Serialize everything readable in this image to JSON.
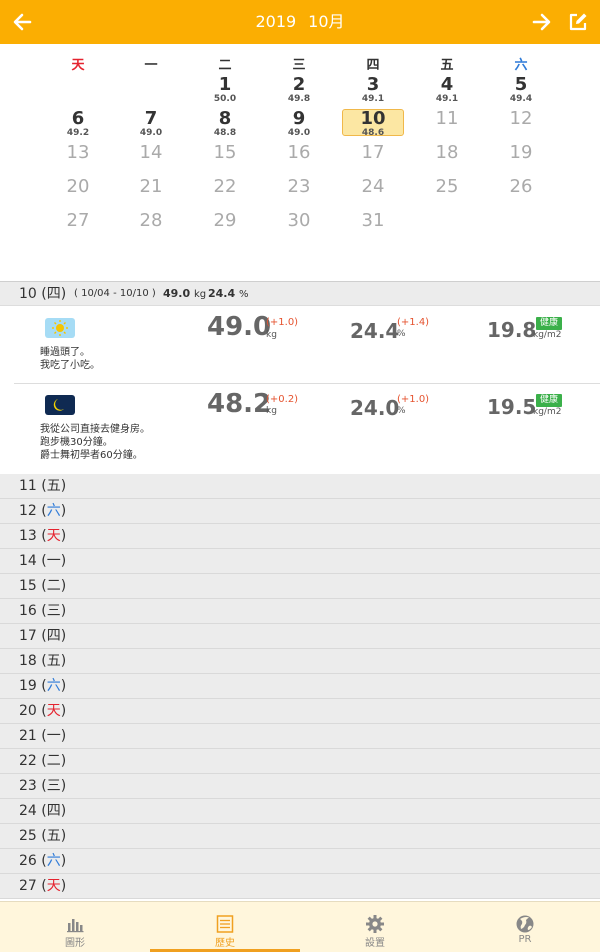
{
  "header": {
    "year": "2019",
    "month": "10月",
    "prev_icon": "arrow-left-icon",
    "next_icon": "arrow-right-icon",
    "edit_icon": "edit-icon"
  },
  "calendar": {
    "weekdays": [
      "天",
      "一",
      "二",
      "三",
      "四",
      "五",
      "六"
    ],
    "days": [
      {
        "n": "1",
        "w": "50.0"
      },
      {
        "n": "2",
        "w": "49.8"
      },
      {
        "n": "3",
        "w": "49.1"
      },
      {
        "n": "4",
        "w": "49.1"
      },
      {
        "n": "5",
        "w": "49.4"
      },
      {
        "n": "6",
        "w": "49.2"
      },
      {
        "n": "7",
        "w": "49.0"
      },
      {
        "n": "8",
        "w": "48.8"
      },
      {
        "n": "9",
        "w": "49.0"
      },
      {
        "n": "10",
        "w": "48.6"
      },
      {
        "n": "11"
      },
      {
        "n": "12"
      },
      {
        "n": "13"
      },
      {
        "n": "14"
      },
      {
        "n": "15"
      },
      {
        "n": "16"
      },
      {
        "n": "17"
      },
      {
        "n": "18"
      },
      {
        "n": "19"
      },
      {
        "n": "20"
      },
      {
        "n": "21"
      },
      {
        "n": "22"
      },
      {
        "n": "23"
      },
      {
        "n": "24"
      },
      {
        "n": "25"
      },
      {
        "n": "26"
      },
      {
        "n": "27"
      },
      {
        "n": "28"
      },
      {
        "n": "29"
      },
      {
        "n": "30"
      },
      {
        "n": "31"
      }
    ],
    "selected": "10"
  },
  "summary": {
    "day": "10 (四)",
    "range": "( 10/04 - 10/10 )",
    "kg_value": "49.0",
    "kg_unit": "kg",
    "pct_value": "24.4",
    "pct_unit": "%"
  },
  "entries": {
    "morning": {
      "icon": "sun-icon",
      "note_line1": "睡過頭了。",
      "note_line2": "我吃了小吃。",
      "weight": "49.0",
      "weight_delta": "(+1.0)",
      "weight_unit": "kg",
      "fat": "24.4",
      "fat_delta": "(+1.4)",
      "fat_unit": "%",
      "bmi": "19.8",
      "bmi_unit": "kg/m2",
      "badge": "健康"
    },
    "evening": {
      "icon": "moon-icon",
      "note_line1": "我從公司直接去健身房。",
      "note_line2": "跑步機30分鐘。",
      "note_line3": "爵士舞初學者60分鐘。",
      "weight": "48.2",
      "weight_delta": "(+0.2)",
      "weight_unit": "kg",
      "fat": "24.0",
      "fat_delta": "(+1.0)",
      "fat_unit": "%",
      "bmi": "19.5",
      "bmi_unit": "kg/m2",
      "badge": "健康"
    }
  },
  "day_list": [
    {
      "num": "11",
      "wd": "五",
      "kind": ""
    },
    {
      "num": "12",
      "wd": "六",
      "kind": "sat"
    },
    {
      "num": "13",
      "wd": "天",
      "kind": "sun"
    },
    {
      "num": "14",
      "wd": "一",
      "kind": ""
    },
    {
      "num": "15",
      "wd": "二",
      "kind": ""
    },
    {
      "num": "16",
      "wd": "三",
      "kind": ""
    },
    {
      "num": "17",
      "wd": "四",
      "kind": ""
    },
    {
      "num": "18",
      "wd": "五",
      "kind": ""
    },
    {
      "num": "19",
      "wd": "六",
      "kind": "sat"
    },
    {
      "num": "20",
      "wd": "天",
      "kind": "sun"
    },
    {
      "num": "21",
      "wd": "一",
      "kind": ""
    },
    {
      "num": "22",
      "wd": "二",
      "kind": ""
    },
    {
      "num": "23",
      "wd": "三",
      "kind": ""
    },
    {
      "num": "24",
      "wd": "四",
      "kind": ""
    },
    {
      "num": "25",
      "wd": "五",
      "kind": ""
    },
    {
      "num": "26",
      "wd": "六",
      "kind": "sat"
    },
    {
      "num": "27",
      "wd": "天",
      "kind": "sun"
    }
  ],
  "tabs": [
    {
      "label": "圖形",
      "icon": "bar-chart-icon"
    },
    {
      "label": "歷史",
      "icon": "list-icon"
    },
    {
      "label": "設置",
      "icon": "gear-icon"
    },
    {
      "label": "PR",
      "icon": "globe-icon"
    }
  ],
  "colors": {
    "accent": "#fbae02",
    "sunday": "#e5232f",
    "saturday": "#2f7bd8",
    "delta": "#e5532f",
    "healthy": "#3bb04a",
    "tab_active": "#f0a020"
  }
}
